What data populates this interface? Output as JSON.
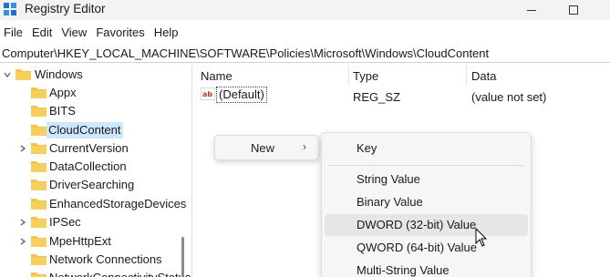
{
  "window": {
    "title": "Registry Editor",
    "app_icon": "registry-editor-icon"
  },
  "menu": [
    "File",
    "Edit",
    "View",
    "Favorites",
    "Help"
  ],
  "address_bar": {
    "path": "Computer\\HKEY_LOCAL_MACHINE\\SOFTWARE\\Policies\\Microsoft\\Windows\\CloudContent"
  },
  "tree": {
    "items": [
      {
        "label": "Windows",
        "expanded": true,
        "selected": false
      },
      {
        "label": "Appx",
        "has_children": false
      },
      {
        "label": "BITS",
        "has_children": false
      },
      {
        "label": "CloudContent",
        "selected": true,
        "has_children": false
      },
      {
        "label": "CurrentVersion",
        "has_children": true
      },
      {
        "label": "DataCollection",
        "has_children": false
      },
      {
        "label": "DriverSearching",
        "has_children": false
      },
      {
        "label": "EnhancedStorageDevices",
        "has_children": false
      },
      {
        "label": "IPSec",
        "has_children": true
      },
      {
        "label": "MpeHttpExt",
        "has_children": true
      },
      {
        "label": "Network Connections",
        "has_children": false
      },
      {
        "label": "NetworkConnectivityStatusIndicator",
        "has_children": false
      }
    ]
  },
  "values_list": {
    "columns": [
      "Name",
      "Type",
      "Data"
    ],
    "rows": [
      {
        "name": "(Default)",
        "type": "REG_SZ",
        "data": "(value not set)",
        "icon": "string-value-icon"
      }
    ]
  },
  "context_menu": {
    "label": "New",
    "submenu_arrow": "›"
  },
  "new_submenu": {
    "items": [
      "Key",
      "String Value",
      "Binary Value",
      "DWORD (32-bit) Value",
      "QWORD (64-bit) Value",
      "Multi-String Value"
    ],
    "hovered": "DWORD (32-bit) Value"
  },
  "colors": {
    "selection": "#cce8ff",
    "folder": "#f3c24b",
    "menu_bg": "#f6f6f6",
    "hover": "#e6e6e6"
  }
}
